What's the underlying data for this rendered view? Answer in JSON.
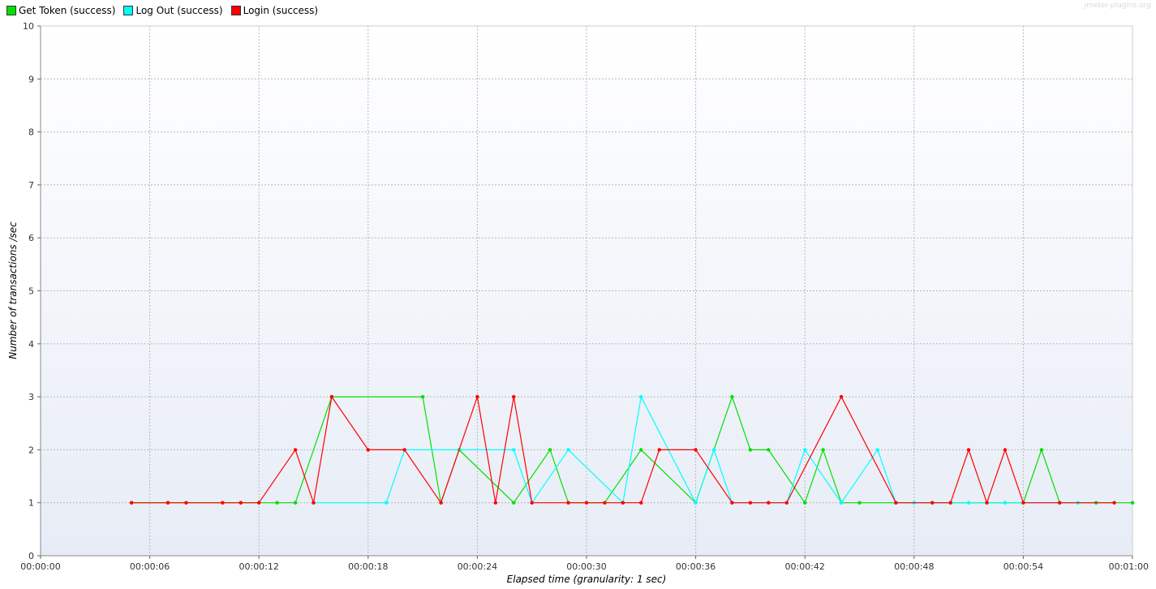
{
  "watermark": "jmeter-plugins.org",
  "chart_data": {
    "type": "line",
    "xlabel": "Elapsed time (granularity: 1 sec)",
    "ylabel": "Number of transactions /sec",
    "xlim": [
      0,
      60
    ],
    "ylim": [
      0,
      10
    ],
    "grid": true,
    "legend_position": "top-left",
    "x_tick_labels": [
      "00:00:00",
      "00:00:06",
      "00:00:12",
      "00:00:18",
      "00:00:24",
      "00:00:30",
      "00:00:36",
      "00:00:42",
      "00:00:48",
      "00:00:54",
      "00:01:00"
    ],
    "x_tick_values": [
      0,
      6,
      12,
      18,
      24,
      30,
      36,
      42,
      48,
      54,
      60
    ],
    "y_tick_labels": [
      "0",
      "1",
      "2",
      "3",
      "4",
      "5",
      "6",
      "7",
      "8",
      "9",
      "10"
    ],
    "series": [
      {
        "name": "Get Token (success)",
        "color": "#00e000",
        "points": [
          [
            5,
            1
          ],
          [
            7,
            1
          ],
          [
            8,
            1
          ],
          [
            10,
            1
          ],
          [
            11,
            1
          ],
          [
            12,
            1
          ],
          [
            13,
            1
          ],
          [
            14,
            1
          ],
          [
            16,
            3
          ],
          [
            21,
            3
          ],
          [
            22,
            1
          ],
          [
            23,
            2
          ],
          [
            26,
            1
          ],
          [
            28,
            2
          ],
          [
            29,
            1
          ],
          [
            31,
            1
          ],
          [
            33,
            2
          ],
          [
            36,
            1
          ],
          [
            38,
            3
          ],
          [
            39,
            2
          ],
          [
            40,
            2
          ],
          [
            42,
            1
          ],
          [
            43,
            2
          ],
          [
            44,
            1
          ],
          [
            45,
            1
          ],
          [
            47,
            1
          ],
          [
            49,
            1
          ],
          [
            50,
            1
          ],
          [
            52,
            1
          ],
          [
            54,
            1
          ],
          [
            55,
            2
          ],
          [
            56,
            1
          ],
          [
            58,
            1
          ],
          [
            60,
            1
          ]
        ]
      },
      {
        "name": "Log Out (success)",
        "color": "#00ffff",
        "points": [
          [
            15,
            1
          ],
          [
            19,
            1
          ],
          [
            20,
            2
          ],
          [
            26,
            2
          ],
          [
            27,
            1
          ],
          [
            29,
            2
          ],
          [
            32,
            1
          ],
          [
            33,
            3
          ],
          [
            36,
            1
          ],
          [
            37,
            2
          ],
          [
            38,
            1
          ],
          [
            41,
            1
          ],
          [
            42,
            2
          ],
          [
            44,
            1
          ],
          [
            46,
            2
          ],
          [
            47,
            1
          ],
          [
            48,
            1
          ],
          [
            51,
            1
          ],
          [
            53,
            1
          ],
          [
            57,
            1
          ]
        ]
      },
      {
        "name": "Login (success)",
        "color": "#ff0000",
        "points": [
          [
            5,
            1
          ],
          [
            7,
            1
          ],
          [
            8,
            1
          ],
          [
            10,
            1
          ],
          [
            11,
            1
          ],
          [
            12,
            1
          ],
          [
            14,
            2
          ],
          [
            15,
            1
          ],
          [
            16,
            3
          ],
          [
            18,
            2
          ],
          [
            20,
            2
          ],
          [
            22,
            1
          ],
          [
            24,
            3
          ],
          [
            25,
            1
          ],
          [
            26,
            3
          ],
          [
            27,
            1
          ],
          [
            29,
            1
          ],
          [
            30,
            1
          ],
          [
            31,
            1
          ],
          [
            32,
            1
          ],
          [
            33,
            1
          ],
          [
            34,
            2
          ],
          [
            36,
            2
          ],
          [
            38,
            1
          ],
          [
            39,
            1
          ],
          [
            40,
            1
          ],
          [
            41,
            1
          ],
          [
            44,
            3
          ],
          [
            47,
            1
          ],
          [
            49,
            1
          ],
          [
            50,
            1
          ],
          [
            51,
            2
          ],
          [
            52,
            1
          ],
          [
            53,
            2
          ],
          [
            54,
            1
          ],
          [
            56,
            1
          ],
          [
            59,
            1
          ]
        ]
      }
    ]
  }
}
